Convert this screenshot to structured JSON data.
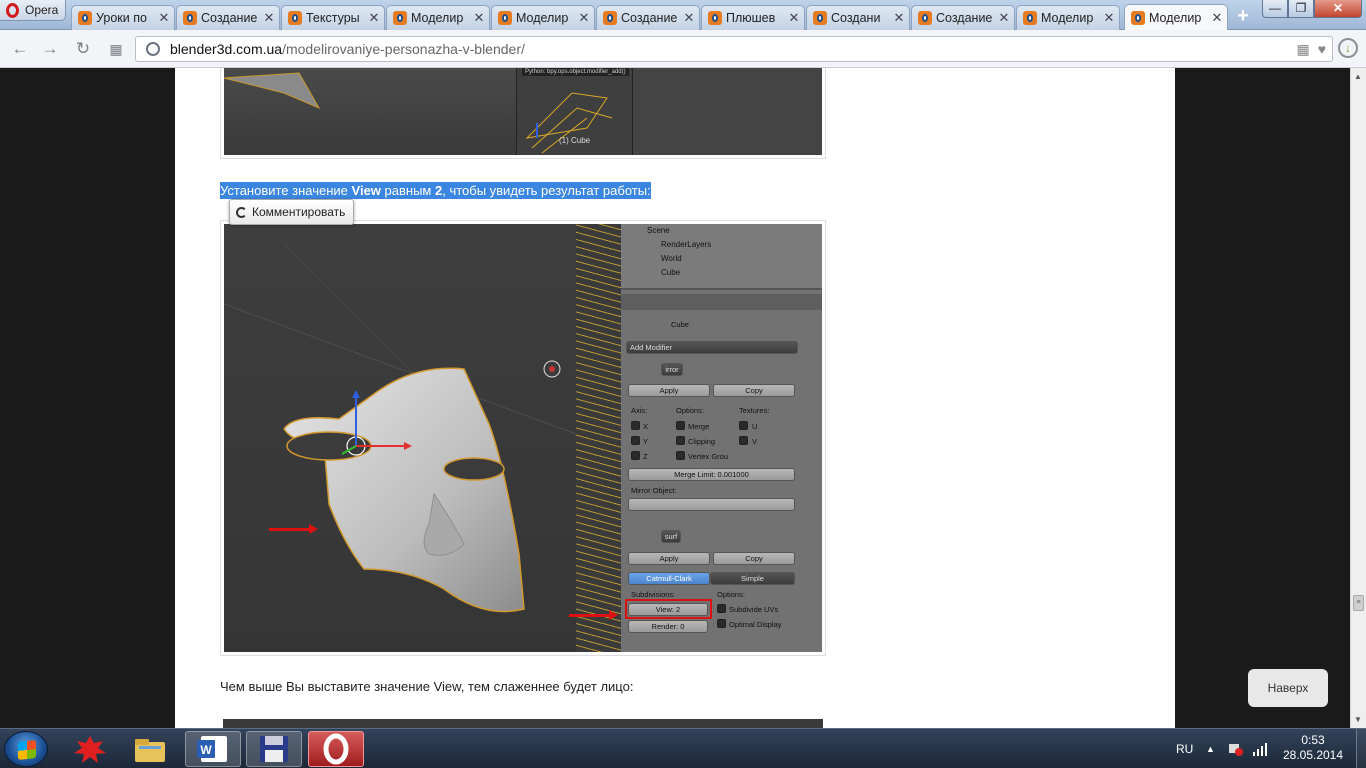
{
  "browser": {
    "menu_label": "Opera",
    "tabs": [
      {
        "title": "Уроки по",
        "active": false
      },
      {
        "title": "Создание",
        "active": false
      },
      {
        "title": "Текстуры",
        "active": false
      },
      {
        "title": "Моделир",
        "active": false
      },
      {
        "title": "Моделир",
        "active": false
      },
      {
        "title": "Создание",
        "active": false
      },
      {
        "title": "Плюшев",
        "active": false
      },
      {
        "title": "Создани",
        "active": false
      },
      {
        "title": "Создание",
        "active": false
      },
      {
        "title": "Моделир",
        "active": false
      },
      {
        "title": "Моделир",
        "active": true
      }
    ],
    "address": {
      "host": "blender3d.com.ua",
      "path": "/modelirovaniye-personazha-v-blender/"
    },
    "window_buttons": {
      "minimize": "—",
      "maximize": "❐",
      "close": "✕"
    }
  },
  "article": {
    "selected_text": {
      "part1": "Установите значение ",
      "bold1": "View",
      "part2": " равным ",
      "bold2": "2",
      "part3": ", чтобы увидеть результат работы:"
    },
    "comment_button": "Комментировать",
    "paragraph": "Чем выше Вы выставите значение View, тем слаженнее будет лицо:",
    "scroll_top_button": "Наверх",
    "screenshot1": {
      "label": "(1) Cube",
      "python_tip": "Python: bpy.ops.object.modifier_add()"
    },
    "screenshot2": {
      "outliner": [
        "Scene",
        "RenderLayers",
        "World",
        "Cube"
      ],
      "object_name": "Cube",
      "add_modifier": "Add Modifier",
      "mirror": {
        "name": "irror",
        "apply": "Apply",
        "copy": "Copy",
        "axis_label": "Axis:",
        "options_label": "Options:",
        "textures_label": "Textures:",
        "axes": [
          "X",
          "Y",
          "Z"
        ],
        "options": [
          "Merge",
          "Clipping",
          "Vertex Grou"
        ],
        "textures": [
          "U",
          "V"
        ],
        "merge_limit": "Merge Limit: 0.001000",
        "mirror_object": "Mirror Object:"
      },
      "subsurf": {
        "name": "surf",
        "apply": "Apply",
        "copy": "Copy",
        "catmull": "Catmull-Clark",
        "simple": "Simple",
        "subdivisions_label": "Subdivisions:",
        "options_label": "Options:",
        "view": "View: 2",
        "render": "Render: 0",
        "subdivide_uvs": "Subdivide UVs",
        "optimal_display": "Optimal Display"
      }
    }
  },
  "taskbar": {
    "language": "RU",
    "time": "0:53",
    "date": "28.05.2014"
  }
}
